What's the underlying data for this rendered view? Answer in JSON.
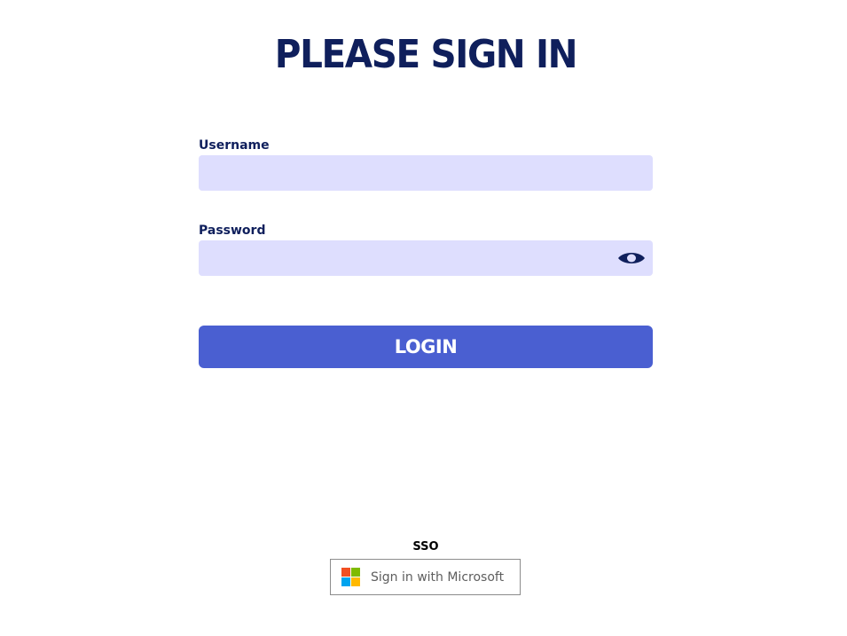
{
  "heading": "PLEASE SIGN IN",
  "form": {
    "username": {
      "label": "Username",
      "value": "",
      "placeholder": ""
    },
    "password": {
      "label": "Password",
      "value": "",
      "placeholder": "",
      "toggle_icon": "eye-icon"
    },
    "login_label": "LOGIN"
  },
  "sso": {
    "label": "SSO",
    "microsoft_button_label": "Sign in with Microsoft",
    "microsoft_logo_colors": [
      "#f25022",
      "#7fba00",
      "#00a4ef",
      "#ffb900"
    ]
  },
  "colors": {
    "heading": "#0f1f5c",
    "input_background": "#dedefe",
    "login_button": "#4a5fd1",
    "login_text": "#ffffff"
  }
}
